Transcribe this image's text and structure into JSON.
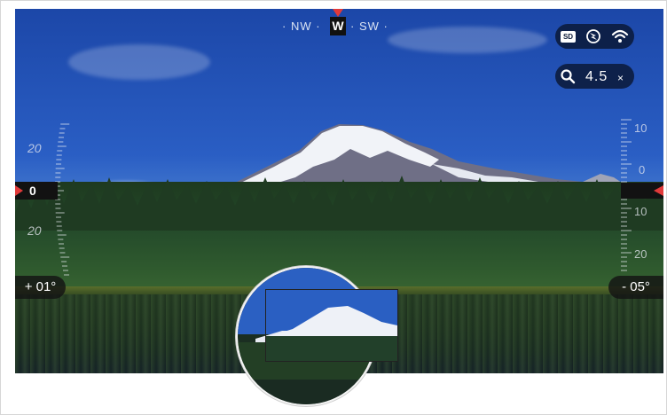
{
  "compass": {
    "left_label": "· NW ·",
    "heading": "W",
    "right_label": "· SW ·"
  },
  "status": {
    "sd_label": "SD",
    "icons": [
      "sd-card-icon",
      "compass-icon",
      "wifi-icon"
    ]
  },
  "zoom": {
    "value": "4.5",
    "unit": "×",
    "icon": "magnifier-icon"
  },
  "left_scale": {
    "upper_label": "20",
    "lower_label": "20",
    "level_value": "0"
  },
  "right_scale": {
    "top_label": "10",
    "middle_label": "0",
    "lower_label": "10",
    "bottom_label": "20"
  },
  "cant": {
    "left": "+ 01°",
    "right": "- 05°"
  },
  "colors": {
    "accent_marker": "#e23a3a",
    "pill_background": "#0a1937"
  }
}
